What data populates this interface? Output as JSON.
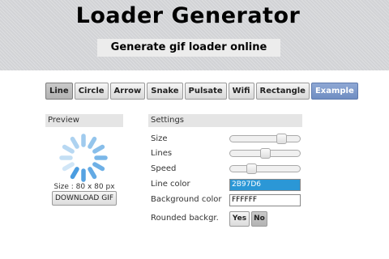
{
  "header": {
    "title": "Loader Generator",
    "subtitle": "Generate gif loader online"
  },
  "tabs": [
    {
      "label": "Line",
      "active": true
    },
    {
      "label": "Circle",
      "active": false
    },
    {
      "label": "Arrow",
      "active": false
    },
    {
      "label": "Snake",
      "active": false
    },
    {
      "label": "Pulsate",
      "active": false
    },
    {
      "label": "Wifi",
      "active": false
    },
    {
      "label": "Rectangle",
      "active": false
    },
    {
      "label": "Example",
      "active": false
    }
  ],
  "preview": {
    "heading": "Preview",
    "size_label": "Size : 80 x 80 px",
    "download_label": "DOWNLOAD GIF",
    "spinner_color": "#4B9DE0",
    "spinner_lines": 12
  },
  "settings": {
    "heading": "Settings",
    "size": {
      "label": "Size",
      "level": 0.78
    },
    "lines": {
      "label": "Lines",
      "level": 0.5
    },
    "speed": {
      "label": "Speed",
      "level": 0.28
    },
    "line_color": {
      "label": "Line color",
      "value": "2B97D6",
      "hex": "#2B97D6"
    },
    "background_color": {
      "label": "Background color",
      "value": "FFFFFF",
      "hex": "#FFFFFF"
    },
    "rounded": {
      "label": "Rounded backgr.",
      "yes": "Yes",
      "no": "No",
      "selected": "No"
    }
  },
  "colors": {
    "header_bg": "#D2D3D6",
    "active_tab": "#B3B3B3",
    "example_tab": "#6F8DC2"
  }
}
